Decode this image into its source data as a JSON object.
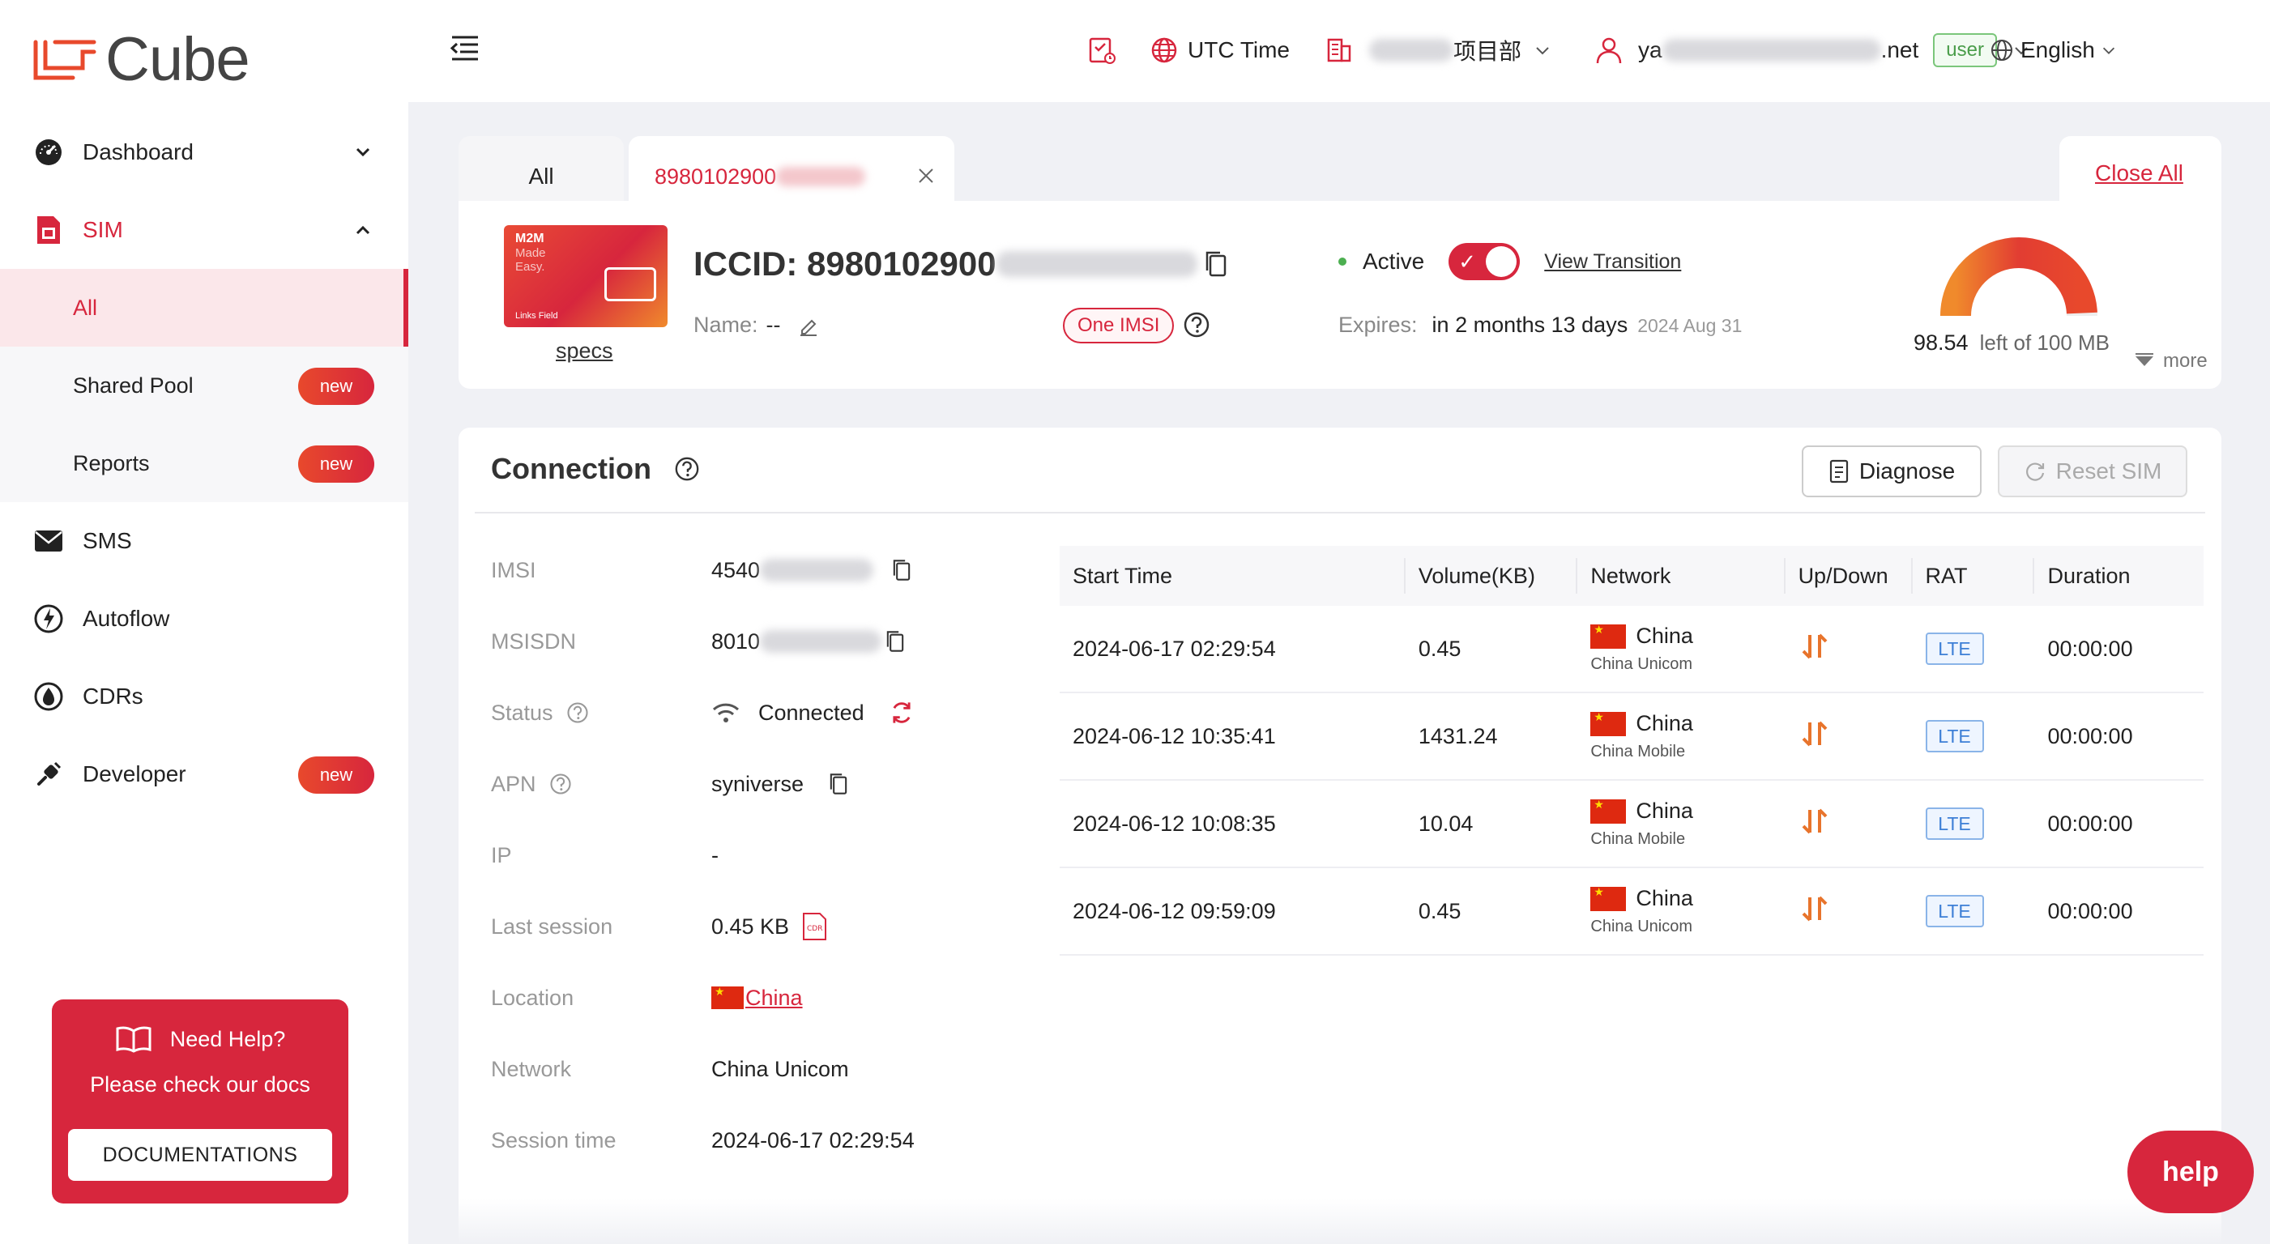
{
  "app": {
    "title": "Cube",
    "brand_color": "#d7263d"
  },
  "sidebar": {
    "items": [
      {
        "label": "Dashboard",
        "icon": "dashboard-icon"
      },
      {
        "label": "SIM",
        "icon": "sim-icon"
      },
      {
        "label": "SMS",
        "icon": "mail-icon"
      },
      {
        "label": "Autoflow",
        "icon": "autoflow-icon"
      },
      {
        "label": "CDRs",
        "icon": "cdr-icon"
      },
      {
        "label": "Developer",
        "icon": "developer-icon",
        "badge": "new"
      }
    ],
    "sim_sub": [
      {
        "label": "All"
      },
      {
        "label": "Shared Pool",
        "badge": "new"
      },
      {
        "label": "Reports",
        "badge": "new"
      }
    ],
    "help": {
      "title": "Need Help?",
      "subtitle": "Please check our docs",
      "button": "DOCUMENTATIONS"
    }
  },
  "header": {
    "timezone": "UTC Time",
    "project_suffix": "项目部",
    "user_prefix": "ya",
    "user_suffix": ".net",
    "role": "user",
    "language": "English"
  },
  "tabs": {
    "all_label": "All",
    "iccid_tab": "8980102900",
    "close_all": "Close All"
  },
  "sim": {
    "card": {
      "line1": "M2M",
      "line2": "Made",
      "line3": "Easy.",
      "brand": "Links Field"
    },
    "specs_link": "specs",
    "iccid_label": "ICCID: 8980102900",
    "name_label": "Name:",
    "name_value": "--",
    "one_imsi": "One IMSI",
    "status": "Active",
    "view_transition": "View Transition",
    "expires_label": "Expires:",
    "expires_value": "in 2 months 13 days",
    "expires_date": "2024 Aug 31",
    "data_used": "98.54",
    "data_total": "left of 100 MB",
    "data_remaining_fraction": 0.9854,
    "more": "more"
  },
  "connection": {
    "title": "Connection",
    "diagnose": "Diagnose",
    "reset": "Reset SIM",
    "fields": {
      "imsi_label": "IMSI",
      "imsi_value": "4540",
      "msisdn_label": "MSISDN",
      "msisdn_value": "8010",
      "status_label": "Status",
      "status_value": "Connected",
      "apn_label": "APN",
      "apn_value": "syniverse",
      "ip_label": "IP",
      "ip_value": "-",
      "last_session_label": "Last session",
      "last_session_value": "0.45 KB",
      "location_label": "Location",
      "location_value": "China",
      "network_label": "Network",
      "network_value": "China Unicom",
      "session_time_label": "Session time",
      "session_time_value": "2024-06-17 02:29:54"
    },
    "table": {
      "headers": [
        "Start Time",
        "Volume(KB)",
        "Network",
        "Up/Down",
        "RAT",
        "Duration"
      ],
      "rows": [
        {
          "start": "2024-06-17 02:29:54",
          "volume": "0.45",
          "country": "China",
          "carrier": "China Unicom",
          "rat": "LTE",
          "duration": "00:00:00"
        },
        {
          "start": "2024-06-12 10:35:41",
          "volume": "1431.24",
          "country": "China",
          "carrier": "China Mobile",
          "rat": "LTE",
          "duration": "00:00:00"
        },
        {
          "start": "2024-06-12 10:08:35",
          "volume": "10.04",
          "country": "China",
          "carrier": "China Mobile",
          "rat": "LTE",
          "duration": "00:00:00"
        },
        {
          "start": "2024-06-12 09:59:09",
          "volume": "0.45",
          "country": "China",
          "carrier": "China Unicom",
          "rat": "LTE",
          "duration": "00:00:00"
        }
      ]
    }
  },
  "help_button": "help"
}
